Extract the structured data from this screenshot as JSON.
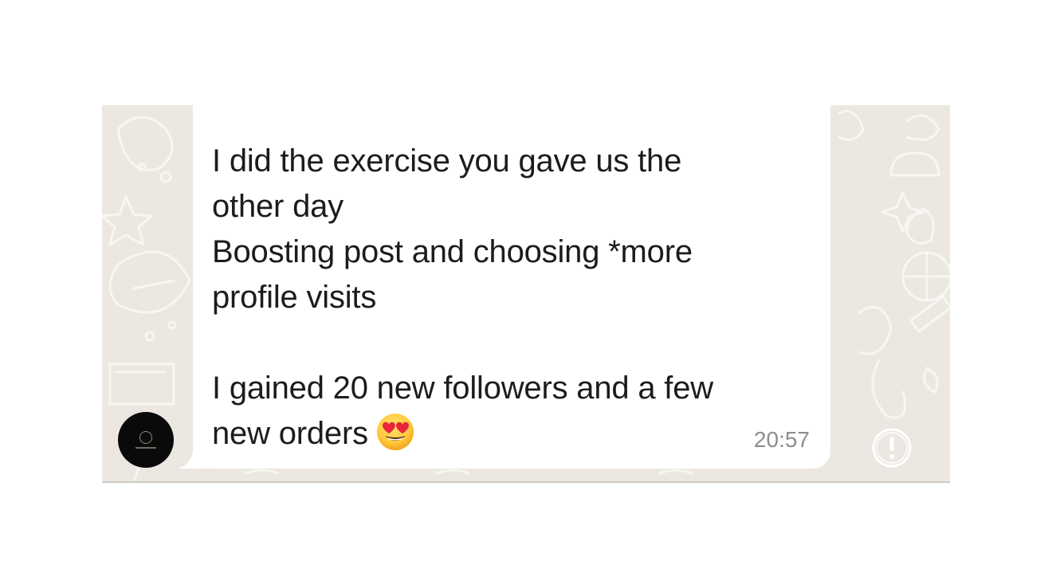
{
  "chat": {
    "wallpaper_color": "#ECE8E1",
    "bubble_color": "#FFFFFF",
    "sender_avatar": {
      "icon": "brand-logo-avatar",
      "color": "#0A0A0A"
    },
    "message": {
      "lines": [
        "I did the exercise you gave us the",
        "other day",
        "Boosting post and choosing *more",
        "profile visits",
        "",
        "I gained 20 new followers and a few",
        "new orders"
      ],
      "emoji": "heart-eyes-emoji",
      "time": "20:57"
    },
    "status_icon": "exclamation-circle-icon"
  }
}
